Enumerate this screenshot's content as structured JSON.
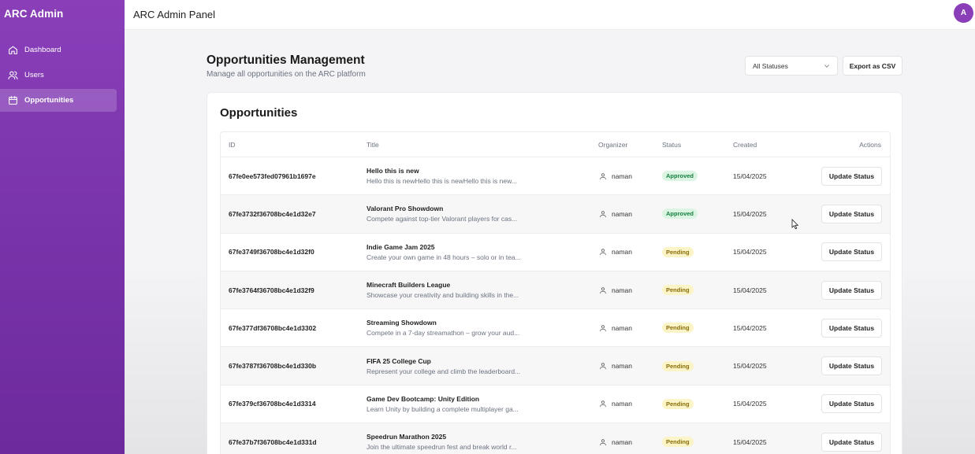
{
  "sidebar": {
    "brand": "ARC Admin",
    "items": [
      {
        "label": "Dashboard",
        "icon": "home-icon"
      },
      {
        "label": "Users",
        "icon": "users-icon"
      },
      {
        "label": "Opportunities",
        "icon": "calendar-icon",
        "active": true
      }
    ]
  },
  "header": {
    "title": "ARC Admin Panel",
    "avatar_initial": "A"
  },
  "page": {
    "title": "Opportunities Management",
    "subtitle": "Manage all opportunities on the ARC platform",
    "status_filter": "All Statuses",
    "export_label": "Export as CSV"
  },
  "table": {
    "card_title": "Opportunities",
    "columns": {
      "id": "ID",
      "title": "Title",
      "organizer": "Organizer",
      "status": "Status",
      "created": "Created",
      "actions": "Actions"
    },
    "action_label": "Update Status",
    "rows": [
      {
        "id": "67fe0ee573fed07961b1697e",
        "title": "Hello this is new",
        "desc": "Hello this is newHello this is newHello this is new...",
        "organizer": "naman",
        "status": "Approved",
        "created": "15/04/2025"
      },
      {
        "id": "67fe3732f36708bc4e1d32e7",
        "title": "Valorant Pro Showdown",
        "desc": "Compete against top-tier Valorant players for cas...",
        "organizer": "naman",
        "status": "Approved",
        "created": "15/04/2025"
      },
      {
        "id": "67fe3749f36708bc4e1d32f0",
        "title": "Indie Game Jam 2025",
        "desc": "Create your own game in 48 hours – solo or in tea...",
        "organizer": "naman",
        "status": "Pending",
        "created": "15/04/2025"
      },
      {
        "id": "67fe3764f36708bc4e1d32f9",
        "title": "Minecraft Builders League",
        "desc": "Showcase your creativity and building skills in the...",
        "organizer": "naman",
        "status": "Pending",
        "created": "15/04/2025"
      },
      {
        "id": "67fe377df36708bc4e1d3302",
        "title": "Streaming Showdown",
        "desc": "Compete in a 7-day streamathon – grow your aud...",
        "organizer": "naman",
        "status": "Pending",
        "created": "15/04/2025"
      },
      {
        "id": "67fe3787f36708bc4e1d330b",
        "title": "FIFA 25 College Cup",
        "desc": "Represent your college and climb the leaderboard...",
        "organizer": "naman",
        "status": "Pending",
        "created": "15/04/2025"
      },
      {
        "id": "67fe379cf36708bc4e1d3314",
        "title": "Game Dev Bootcamp: Unity Edition",
        "desc": "Learn Unity by building a complete multiplayer ga...",
        "organizer": "naman",
        "status": "Pending",
        "created": "15/04/2025"
      },
      {
        "id": "67fe37b7f36708bc4e1d331d",
        "title": "Speedrun Marathon 2025",
        "desc": "Join the ultimate speedrun fest and break world r...",
        "organizer": "naman",
        "status": "Pending",
        "created": "15/04/2025"
      }
    ]
  },
  "colors": {
    "sidebar": "#7a34ac",
    "approved_bg": "#dcf5e3",
    "approved_text": "#15803d",
    "pending_bg": "#fbf4c6",
    "pending_text": "#8a6d0b"
  }
}
